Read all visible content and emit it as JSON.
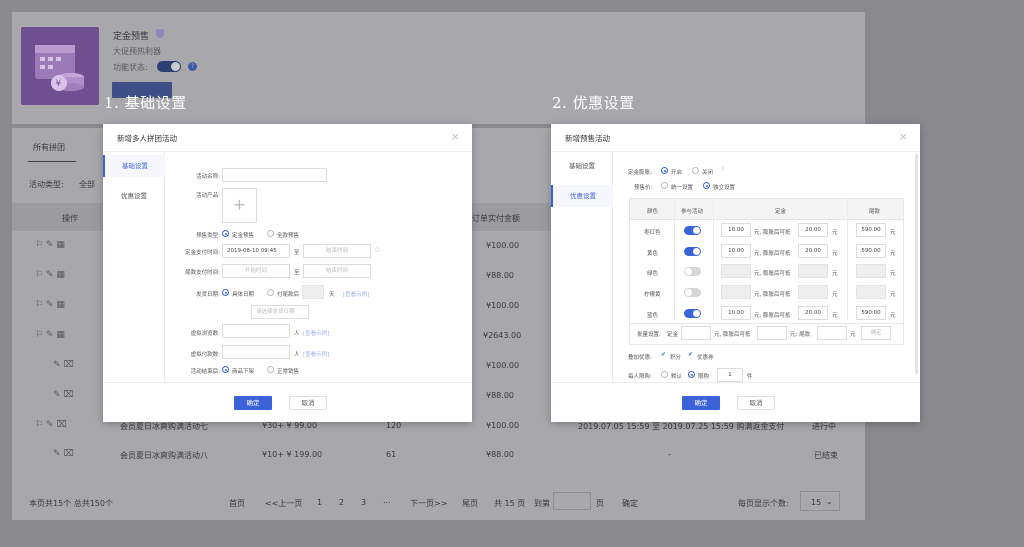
{
  "background": {
    "product_title": "定金预售",
    "product_subtitle": "大促预热利器",
    "status_label": "功能状态:",
    "help_icon": "question-icon",
    "new_button": "+ 新增活动",
    "tab_all": "所有拼团",
    "filter_label": "活动类型:",
    "filter_value": "全部",
    "col_ops": "操作",
    "col_paid": "订单实付金额",
    "paid_values": [
      "¥100.00",
      "¥88.00",
      "¥100.00",
      "¥2643.00",
      "¥100.00",
      "¥88.00",
      "¥100.00",
      "¥88.00"
    ],
    "row7_name": "会员夏日冰爽购满活动七",
    "row7_price": "¥30+ ¥ 99.00",
    "row7_count": "120",
    "row7_time": "2019.07.05 15:59 至 2019.07.25 15:59 购满返金支付",
    "row7_status": "进行中",
    "row8_name": "会员夏日冰爽购满活动八",
    "row8_price": "¥10+ ¥ 199.00",
    "row8_count": "61",
    "row8_time": "-",
    "row8_status": "已结束",
    "footer_total": "本页共15个  总共150个",
    "pager": {
      "first": "首页",
      "prev": "<<上一页",
      "pages": [
        "1",
        "2",
        "3"
      ],
      "ellipsis": "...",
      "next": "下一页>>",
      "last": "尾页",
      "total": "共 15 页",
      "goto": "到第",
      "page_unit": "页",
      "confirm": "确定"
    },
    "per_page_label": "每页显示个数:",
    "per_page_value": "15"
  },
  "steps": {
    "step1": "1. 基础设置",
    "step2": "2. 优惠设置"
  },
  "modal1": {
    "title": "新增多人拼团活动",
    "side": [
      "基础设置",
      "优惠设置"
    ],
    "fields": {
      "name_label": "活动名称:",
      "product_label": "活动产品:",
      "presale_type_label": "预售类型:",
      "presale_opt1": "定金预售",
      "presale_opt2": "全款预售",
      "deposit_time_label": "定金支付时间:",
      "deposit_start": "2019-08-10 09:45",
      "to": "至",
      "end_placeholder": "结束时间",
      "final_time_label": "尾款支付时间:",
      "start_placeholder": "开始时间",
      "ship_label": "发货日期:",
      "ship_opt1": "具体日期",
      "ship_opt2": "付尾款后",
      "day_unit": "天",
      "ship_hint": "[查看示例]",
      "ship_date_placeholder": "请选择发货日期",
      "virtual_browse_label": "虚拟浏览数:",
      "virtual_pay_label": "虚拟付款数:",
      "person_unit": "人",
      "view_example": "[查看示例]",
      "end_way_label": "活动结束后:",
      "end_opt1": "商品下架",
      "end_opt2": "正常销售"
    },
    "ok": "确定",
    "cancel": "取消"
  },
  "modal2": {
    "title": "新增预售活动",
    "side": [
      "基础设置",
      "优惠设置"
    ],
    "deposit_inflate_label": "定金膨胀:",
    "inflate_on": "开启",
    "inflate_off": "关闭",
    "presale_price_label": "预售价:",
    "price_opt1": "统一设置",
    "price_opt2": "独立设置",
    "table_headers": [
      "颜色",
      "参与活动",
      "定金",
      "尾款"
    ],
    "yuan": "元",
    "offset_text": "元, 膨胀后可抵",
    "rows": [
      {
        "color": "枣红色",
        "active": true,
        "deposit": "10.00",
        "offset": "20.00",
        "final": "590.00"
      },
      {
        "color": "黄色",
        "active": true,
        "deposit": "10.00",
        "offset": "20.00",
        "final": "590.00"
      },
      {
        "color": "绿色",
        "active": false,
        "deposit": "",
        "offset": "",
        "final": ""
      },
      {
        "color": "柠檬黄",
        "active": false,
        "deposit": "",
        "offset": "",
        "final": ""
      },
      {
        "color": "蓝色",
        "active": true,
        "deposit": "10.00",
        "offset": "20.00",
        "final": "590.00"
      }
    ],
    "batch_label": "批量设置:",
    "batch_deposit": "定金",
    "batch_offset": "元, 膨胀后可抵",
    "batch_final": "元; 尾款",
    "batch_ok": "确定",
    "stack_label": "叠加优惠:",
    "stack_opt1": "积分",
    "stack_opt2": "优惠券",
    "limit_label": "每人限购:",
    "limit_opt1": "默认",
    "limit_opt2": "限购",
    "limit_value": "1",
    "limit_unit": "件",
    "ok": "确定",
    "cancel": "取消"
  },
  "colors": {
    "accent": "#3b63d8",
    "overlay": "#8a8a8e"
  }
}
